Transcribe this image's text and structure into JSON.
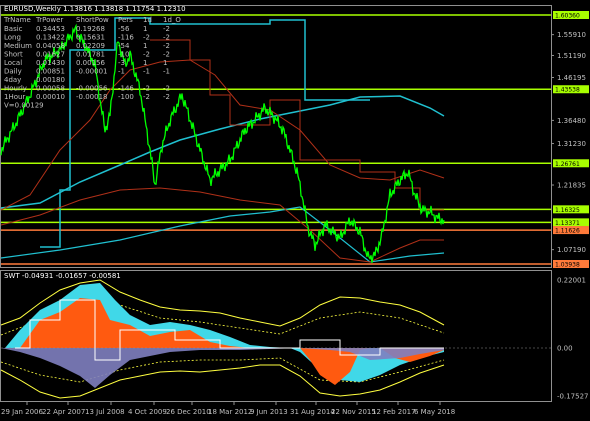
{
  "header": {
    "main_title": "EURUSD,Weekly  1.13816 1.13818 1.11754 1.12310",
    "sub_title": "SWT -0.04931 -0.01657 -0.00581"
  },
  "table": {
    "columns": [
      "TrName",
      "TrPower",
      "ShortPow",
      "Pers",
      "1d",
      "1d_O"
    ],
    "rows": [
      [
        "Basic",
        "0.34453",
        "0.19268",
        "-56",
        "1",
        "-2"
      ],
      [
        "Long",
        "0.13422",
        "0.15631",
        "-116",
        "-2",
        "-2"
      ],
      [
        "Medium",
        "0.04058",
        "0.02209",
        "-54",
        "1",
        "-2"
      ],
      [
        "Short",
        "0.01627",
        "0.01781",
        "-10",
        "-2",
        "-2"
      ],
      [
        "Local",
        "0.01430",
        "0.00156",
        "-3",
        "1",
        "1"
      ],
      [
        "Daily",
        "0.00851",
        "-0.00001",
        "-1",
        "-1",
        "-1"
      ],
      [
        "4day",
        "0.00180",
        "",
        "",
        "",
        ""
      ],
      [
        "Hourly",
        "0.00058",
        "-0.00056",
        "-146",
        "-2",
        "-2"
      ],
      [
        "1Hour",
        "0.00010",
        "-0.00018",
        "-100",
        "-2",
        "-2"
      ]
    ],
    "footer": "V=0.00129"
  },
  "price_scale": [
    {
      "label": "1.60360",
      "highlight": "#a8ff00"
    },
    {
      "label": "1.55910",
      "highlight": null
    },
    {
      "label": "1.51190",
      "highlight": null
    },
    {
      "label": "1.46195",
      "highlight": null
    },
    {
      "label": "1.43538",
      "highlight": "#a8ff00"
    },
    {
      "label": "1.36480",
      "highlight": null
    },
    {
      "label": "1.31230",
      "highlight": null
    },
    {
      "label": "1.26761",
      "highlight": "#a8ff00"
    },
    {
      "label": "1.21835",
      "highlight": null
    },
    {
      "label": "1.16325",
      "highlight": "#a8ff00"
    },
    {
      "label": "1.13371",
      "highlight": "#a8ff00"
    },
    {
      "label": "1.11626",
      "highlight": "#ff7a3a"
    },
    {
      "label": "1.07190",
      "highlight": null
    },
    {
      "label": "1.03938",
      "highlight": "#ff7a3a"
    }
  ],
  "indicator_scale": [
    "0.22001",
    "0.00",
    "-0.17527"
  ],
  "time_axis": [
    "29 Jan 2006",
    "22 Apr 2007",
    "13 Jul 2008",
    "4 Oct 2009",
    "26 Dec 2010",
    "18 Mar 2012",
    "9 Jun 2013",
    "31 Aug 2014",
    "22 Nov 2015",
    "12 Feb 2017",
    "6 May 2018"
  ],
  "colors": {
    "background": "#000000",
    "grid": "#c0c0c0",
    "price": "#00ff00",
    "level_green": "#a8ff00",
    "level_orange": "#ff3a00",
    "ma_cyan": "#20c0d0",
    "ma_red": "#b03018",
    "hist_cyan": "#40d8e8",
    "hist_orange": "#ff5a10",
    "hist_blue": "#8080c0",
    "band_yellow": "#ffff40"
  }
}
